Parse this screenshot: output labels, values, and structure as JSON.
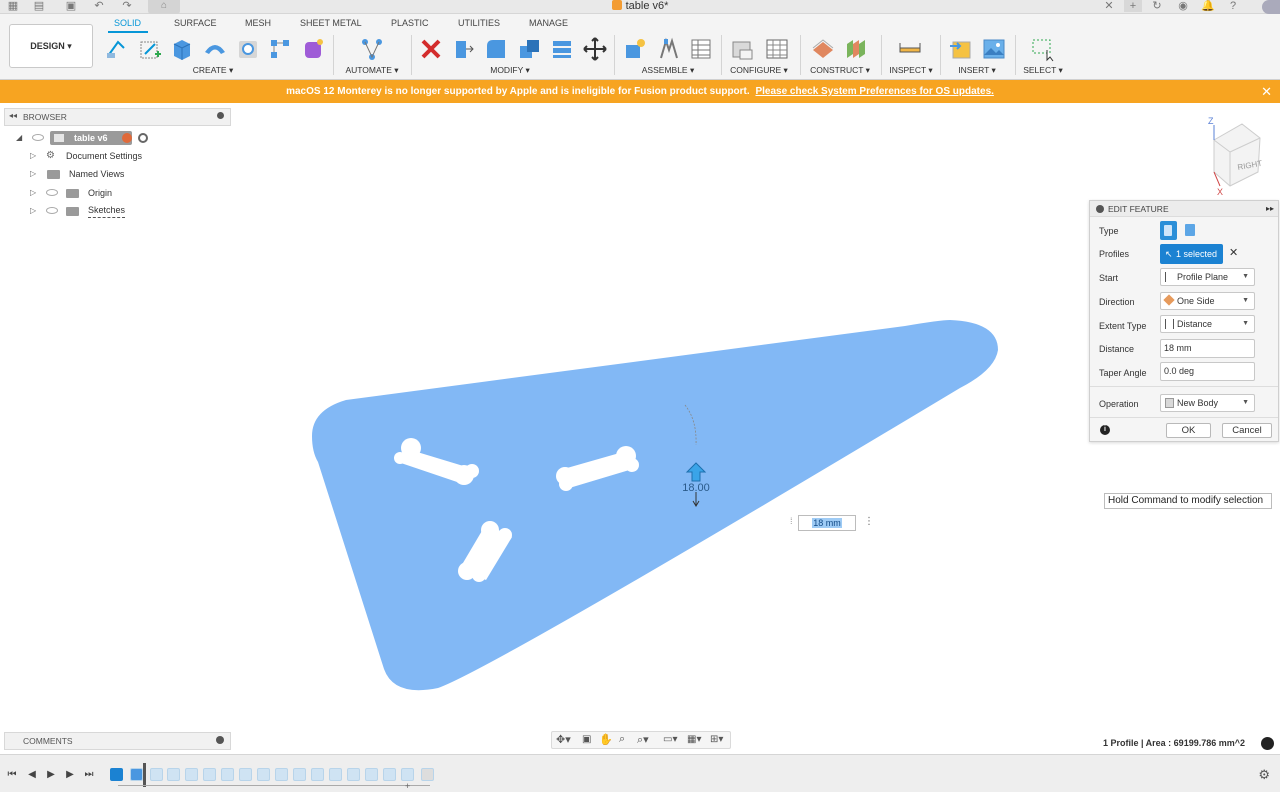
{
  "window": {
    "title": "table v6*"
  },
  "workspace": {
    "mode_label": "DESIGN"
  },
  "tabs": [
    {
      "label": "SOLID"
    },
    {
      "label": "SURFACE"
    },
    {
      "label": "MESH"
    },
    {
      "label": "SHEET METAL"
    },
    {
      "label": "PLASTIC"
    },
    {
      "label": "UTILITIES"
    },
    {
      "label": "MANAGE"
    }
  ],
  "tool_groups": [
    {
      "label": "CREATE ▾"
    },
    {
      "label": "AUTOMATE ▾"
    },
    {
      "label": "MODIFY ▾"
    },
    {
      "label": "ASSEMBLE ▾"
    },
    {
      "label": "CONFIGURE ▾"
    },
    {
      "label": "CONSTRUCT ▾"
    },
    {
      "label": "INSPECT ▾"
    },
    {
      "label": "INSERT ▾"
    },
    {
      "label": "SELECT ▾"
    }
  ],
  "banner": {
    "text": "macOS 12 Monterey is no longer supported by Apple and is ineligible for Fusion product support.",
    "link": "Please check System Preferences for OS updates.",
    "close": "✕"
  },
  "browser": {
    "title": "BROWSER",
    "root": "table v6",
    "items": [
      {
        "label": "Document Settings"
      },
      {
        "label": "Named Views"
      },
      {
        "label": "Origin"
      },
      {
        "label": "Sketches"
      }
    ]
  },
  "viewcube": {
    "face_label": "RIGHT",
    "axis_z": "Z",
    "axis_x": "X"
  },
  "canvas": {
    "manipulator_value": "18.00",
    "dimension_input": "18 mm"
  },
  "edit_feature": {
    "title": "EDIT FEATURE",
    "rows": {
      "type": "Type",
      "profiles": "Profiles",
      "start": "Start",
      "direction": "Direction",
      "extent_type": "Extent Type",
      "distance": "Distance",
      "taper_angle": "Taper Angle",
      "operation": "Operation"
    },
    "values": {
      "profiles": "1 selected",
      "start": "Profile Plane",
      "direction": "One Side",
      "extent_type": "Distance",
      "distance": "18 mm",
      "taper_angle": "0.0 deg",
      "operation": "New Body"
    },
    "ok_label": "OK",
    "cancel_label": "Cancel"
  },
  "tooltip": "Hold Command to modify selection",
  "comments": {
    "title": "COMMENTS"
  },
  "status": {
    "text": "1 Profile | Area : 69199.786 mm^2"
  },
  "colors": {
    "accent": "#0696d7",
    "banner": "#f7a421",
    "body_fill": "#82b8f5"
  }
}
